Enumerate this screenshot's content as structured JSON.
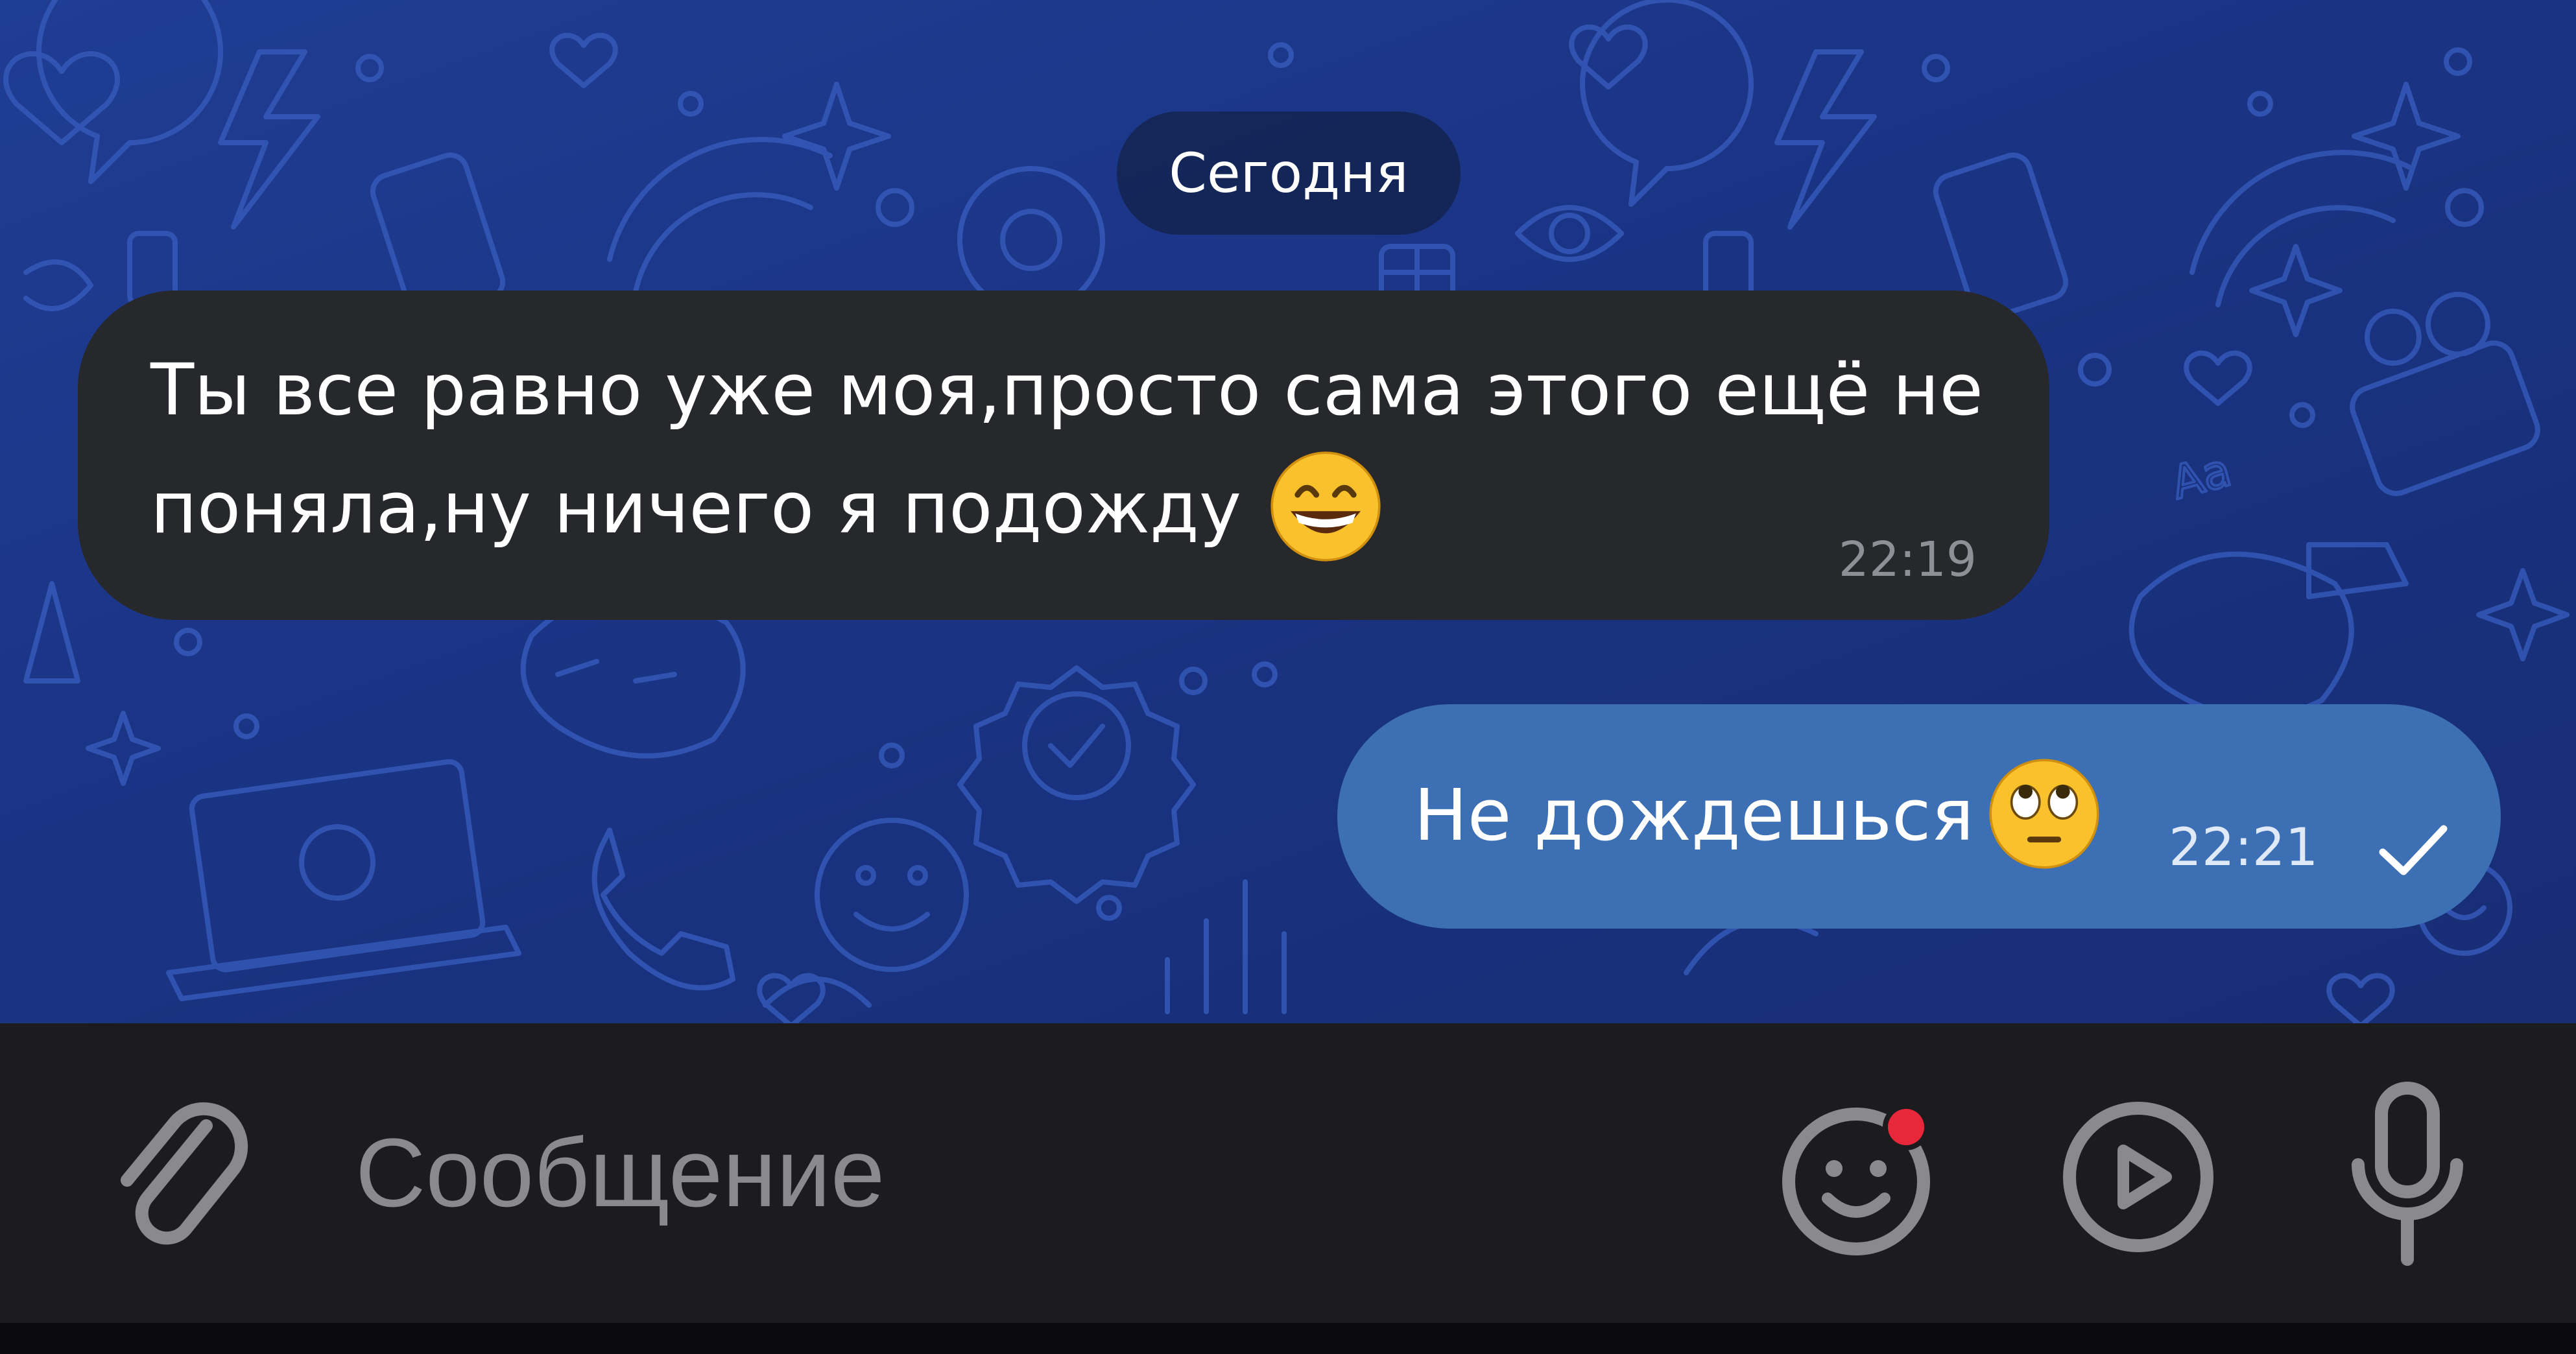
{
  "chat": {
    "date_separator": "Сегодня",
    "messages": [
      {
        "direction": "incoming",
        "text": "Ты все равно уже моя,просто сама этого ещё не поняла,ну ничего я подожду",
        "emoji": "😄",
        "time": "22:19"
      },
      {
        "direction": "outgoing",
        "text": "Не дождешься",
        "emoji": "🙄",
        "time": "22:21",
        "status": "sent-checkmark-icon"
      }
    ]
  },
  "input_bar": {
    "placeholder": "Сообщение",
    "attach_icon": "paperclip-icon",
    "emoji_icon": "smiley-icon",
    "emoji_has_notification": true,
    "video_icon": "play-circle-icon",
    "mic_icon": "microphone-icon"
  },
  "colors": {
    "wallpaper": "#1d3a8e",
    "incoming_bubble": "#27282c",
    "outgoing_bubble": "#3c6fb3",
    "input_bar": "#1c1c1e",
    "notification_dot": "#e8283a"
  }
}
